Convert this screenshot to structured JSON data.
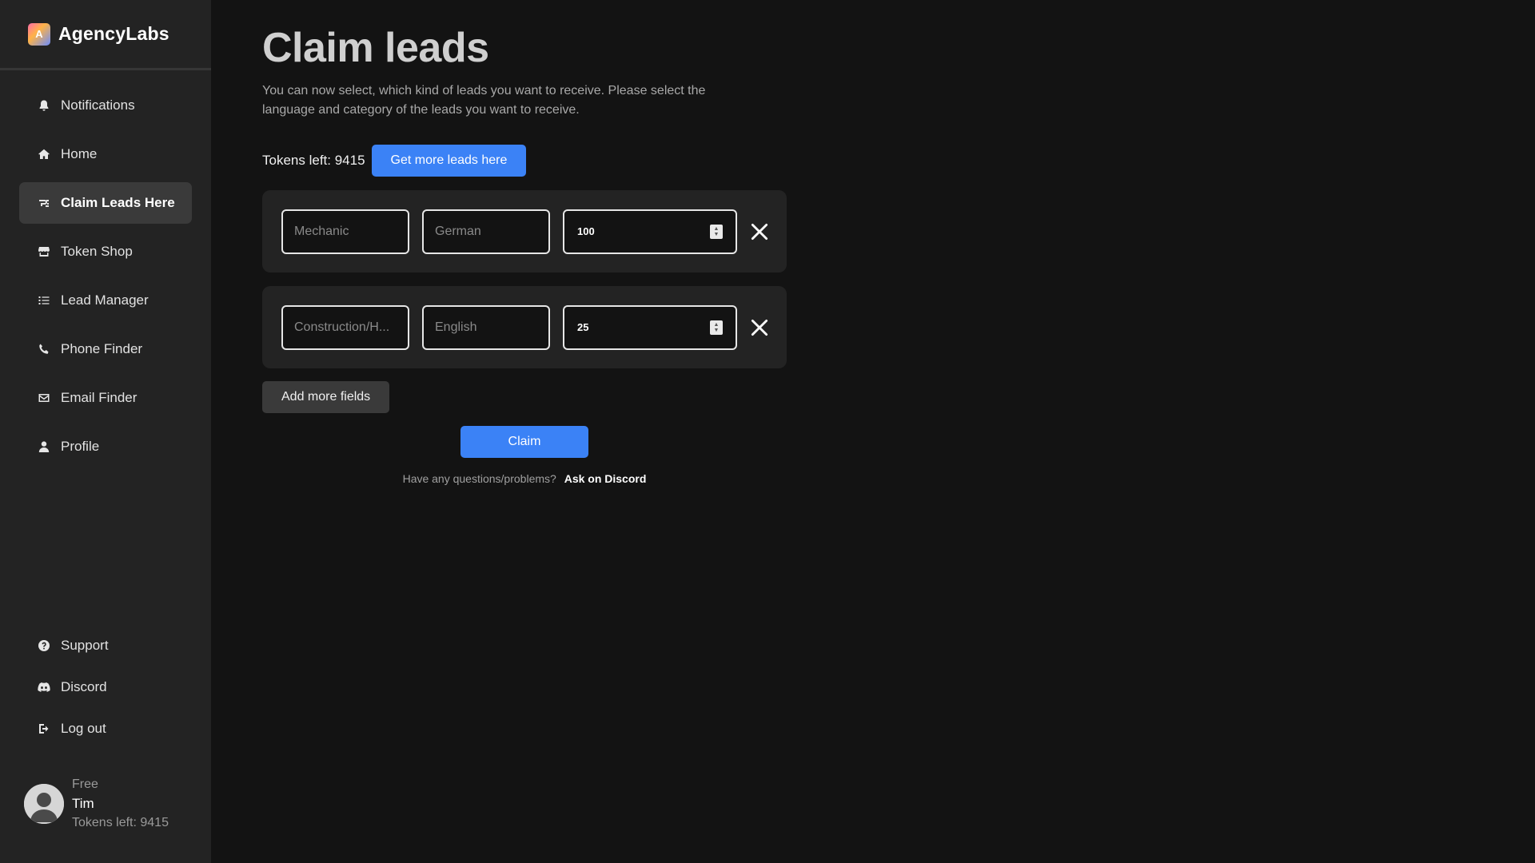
{
  "brand": {
    "name": "AgencyLabs",
    "logo_letter": "A"
  },
  "nav": {
    "items": [
      {
        "label": "Notifications",
        "icon": "bell-icon"
      },
      {
        "label": "Home",
        "icon": "home-icon"
      },
      {
        "label": "Claim Leads Here",
        "icon": "claim-icon",
        "active": true
      },
      {
        "label": "Token Shop",
        "icon": "shop-icon"
      },
      {
        "label": "Lead Manager",
        "icon": "list-icon"
      },
      {
        "label": "Phone Finder",
        "icon": "phone-icon"
      },
      {
        "label": "Email Finder",
        "icon": "mail-icon"
      },
      {
        "label": "Profile",
        "icon": "user-icon"
      }
    ],
    "bottom": [
      {
        "label": "Support",
        "icon": "help-circle-icon"
      },
      {
        "label": "Discord",
        "icon": "discord-icon"
      },
      {
        "label": "Log out",
        "icon": "logout-icon"
      }
    ]
  },
  "user": {
    "plan": "Free",
    "name": "Tim",
    "tokens": "Tokens left: 9415"
  },
  "main": {
    "title": "Claim leads",
    "description": "You can now select, which kind of leads you want to receive. Please select the language and category of the leads you want to receive.",
    "tokens_left": "Tokens left: 9415",
    "get_more_label": "Get more leads here",
    "rows": [
      {
        "category": "Mechanic",
        "language": "German",
        "amount": "100"
      },
      {
        "category": "Construction/H...",
        "language": "English",
        "amount": "25"
      }
    ],
    "add_fields_label": "Add more fields",
    "claim_label": "Claim",
    "help_question": "Have any questions/problems?",
    "help_link": "Ask on Discord"
  },
  "colors": {
    "accent": "#3b82f6",
    "sidebar_bg": "#232323",
    "page_bg": "#131313"
  }
}
